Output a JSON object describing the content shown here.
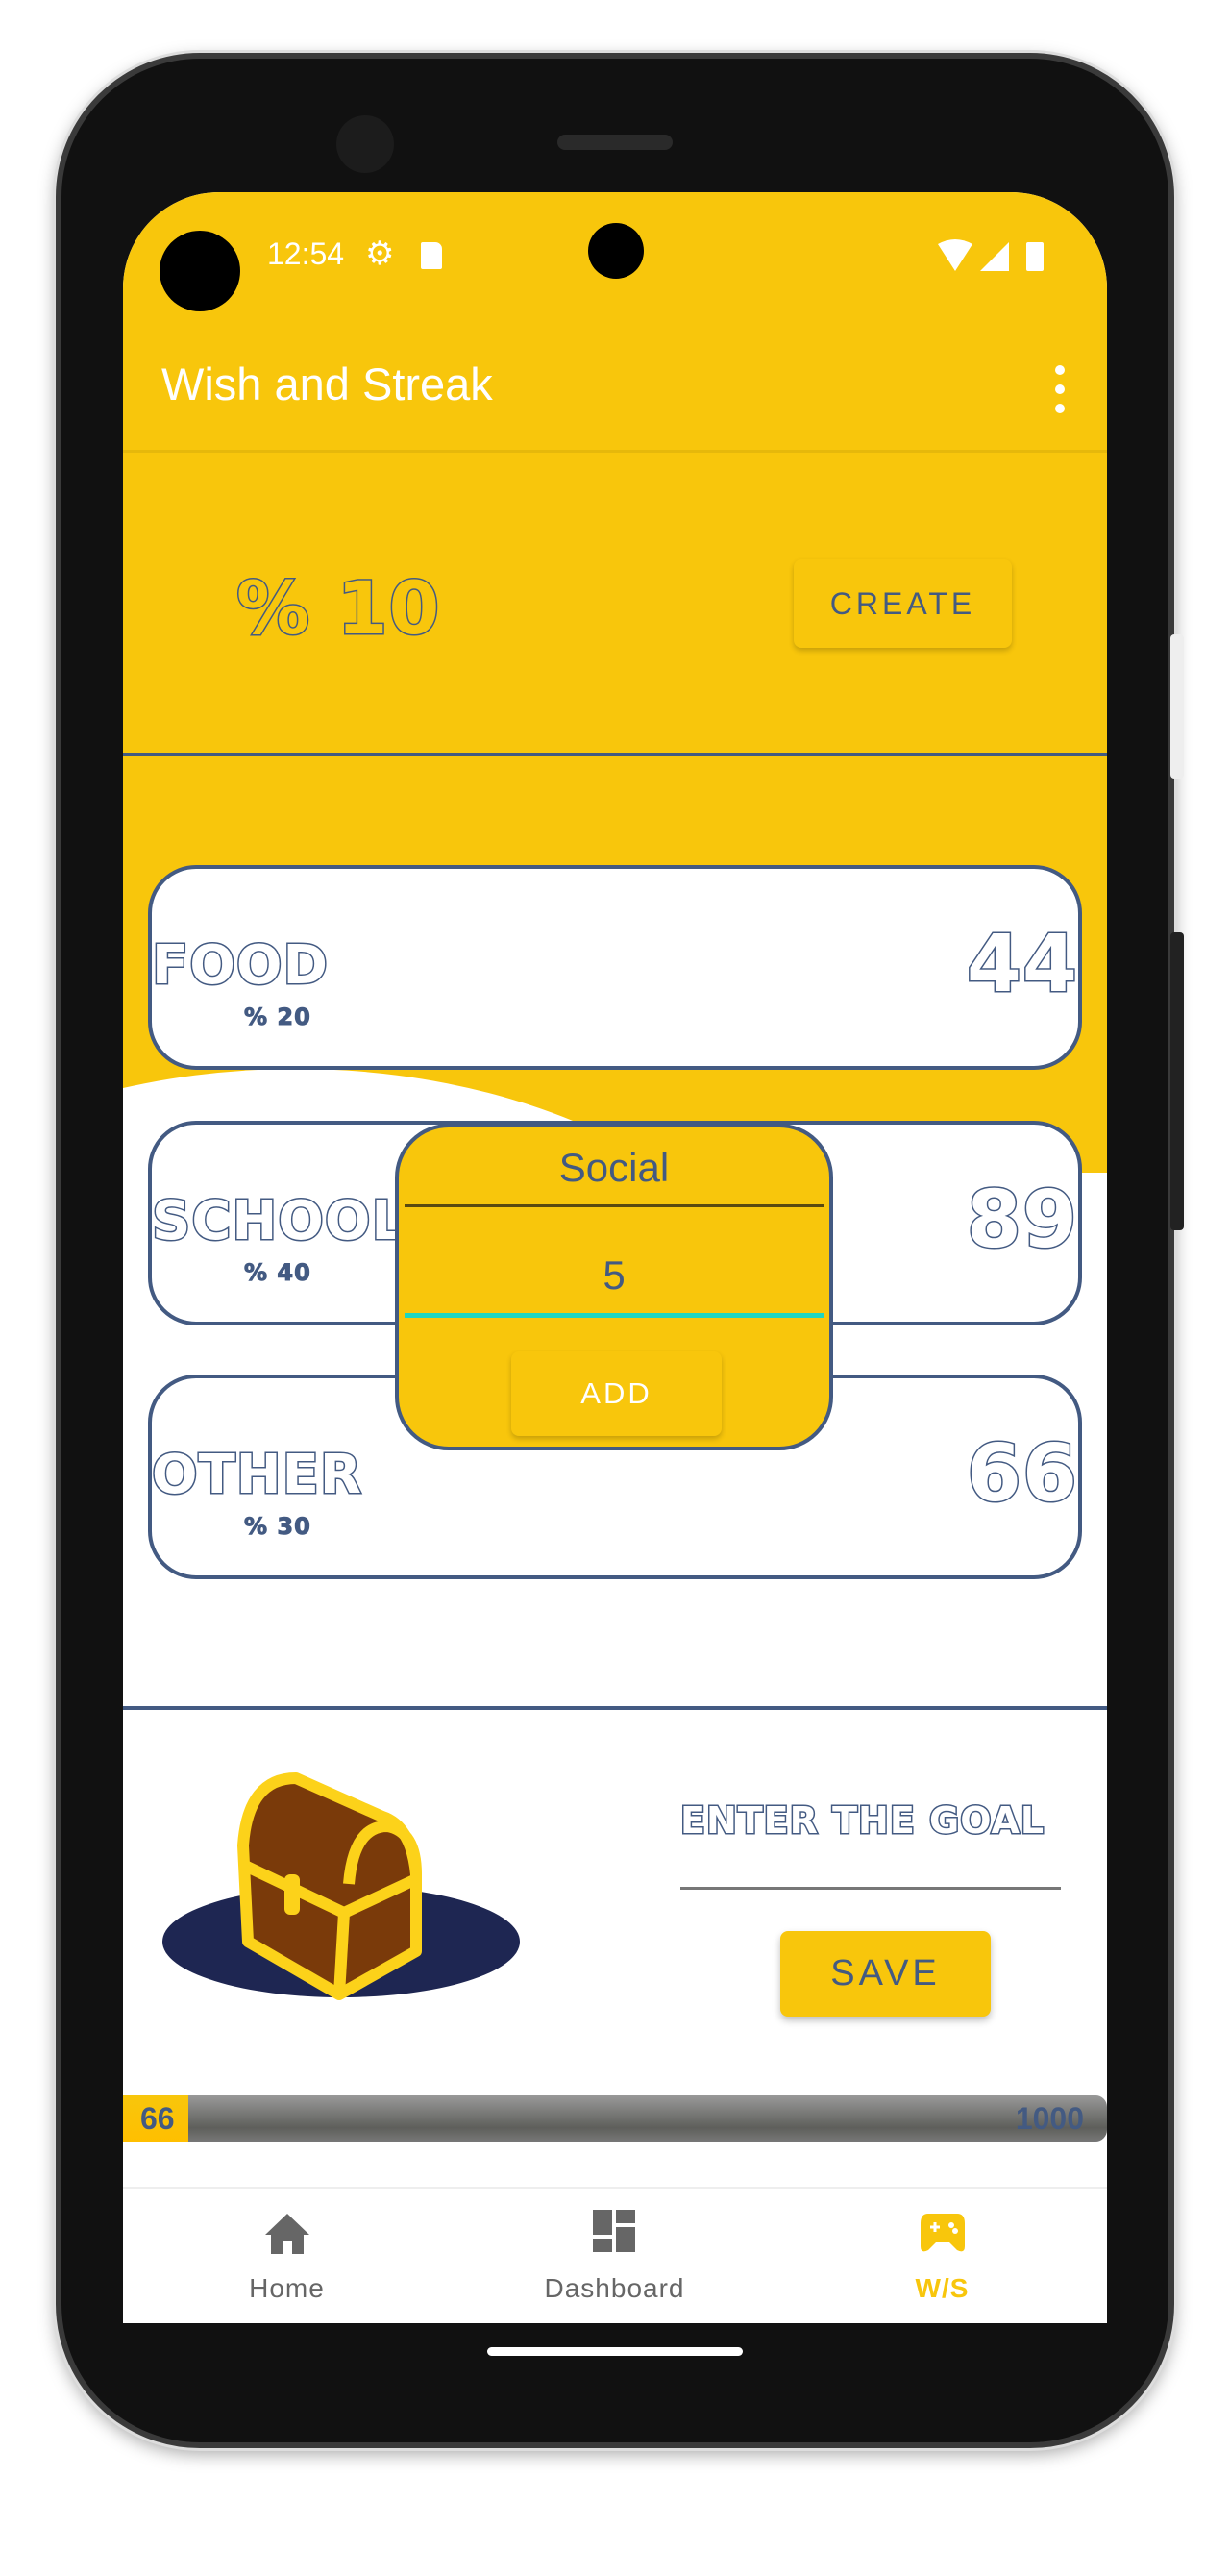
{
  "status_bar": {
    "time": "12:54",
    "icons": [
      "gear-icon",
      "sd-card-icon",
      "wifi-icon",
      "signal-icon",
      "battery-icon"
    ]
  },
  "app_bar": {
    "title": "Wish and Streak",
    "menu_icon": "more-vert-icon"
  },
  "header": {
    "percent_label": "% 10",
    "create_label": "CREATE"
  },
  "categories": [
    {
      "name": "FOOD",
      "percent": "% 20",
      "value": "44"
    },
    {
      "name": "SCHOOL",
      "percent": "% 40",
      "value": "89"
    },
    {
      "name": "OTHER",
      "percent": "% 30",
      "value": "66"
    }
  ],
  "dialog": {
    "name_value": "Social",
    "amount_value": "5",
    "add_label": "ADD"
  },
  "goal": {
    "placeholder": "ENTER THE GOAL",
    "save_label": "SAVE"
  },
  "progress": {
    "current": "66",
    "target": "1000",
    "fraction": 0.066
  },
  "bottom_nav": [
    {
      "label": "Home",
      "icon": "home-icon",
      "active": false
    },
    {
      "label": "Dashboard",
      "icon": "dashboard-icon",
      "active": false
    },
    {
      "label": "W/S",
      "icon": "gamepad-icon",
      "active": true
    }
  ],
  "colors": {
    "primary": "#f8c60c",
    "navy": "#435a82",
    "accent": "#1fd6c0"
  }
}
